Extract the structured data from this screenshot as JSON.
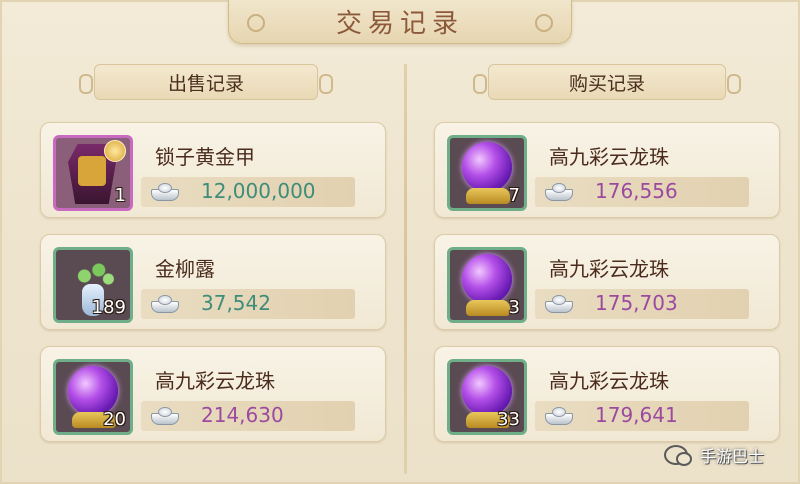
{
  "title": "交易记录",
  "colors": {
    "sell_price": "#3e8d78",
    "buy_price": "#9b4aa0",
    "name_text": "#4a2b1c"
  },
  "sell": {
    "header": "出售记录",
    "items": [
      {
        "name": "锁子黄金甲",
        "qty": "1",
        "price": "12,000,000",
        "icon": "golden-armor-icon",
        "frame": "purple"
      },
      {
        "name": "金柳露",
        "qty": "189",
        "price": "37,542",
        "icon": "willow-dew-vase-icon",
        "frame": "green"
      },
      {
        "name": "高九彩云龙珠",
        "qty": "20",
        "price": "214,630",
        "icon": "dragon-pearl-icon",
        "frame": "green"
      }
    ]
  },
  "buy": {
    "header": "购买记录",
    "items": [
      {
        "name": "高九彩云龙珠",
        "qty": "7",
        "price": "176,556",
        "icon": "dragon-pearl-icon",
        "frame": "green"
      },
      {
        "name": "高九彩云龙珠",
        "qty": "3",
        "price": "175,703",
        "icon": "dragon-pearl-icon",
        "frame": "green"
      },
      {
        "name": "高九彩云龙珠",
        "qty": "33",
        "price": "179,641",
        "icon": "dragon-pearl-icon",
        "frame": "green"
      }
    ]
  },
  "watermark": {
    "text": "手游巴士",
    "icon": "wechat-icon"
  }
}
